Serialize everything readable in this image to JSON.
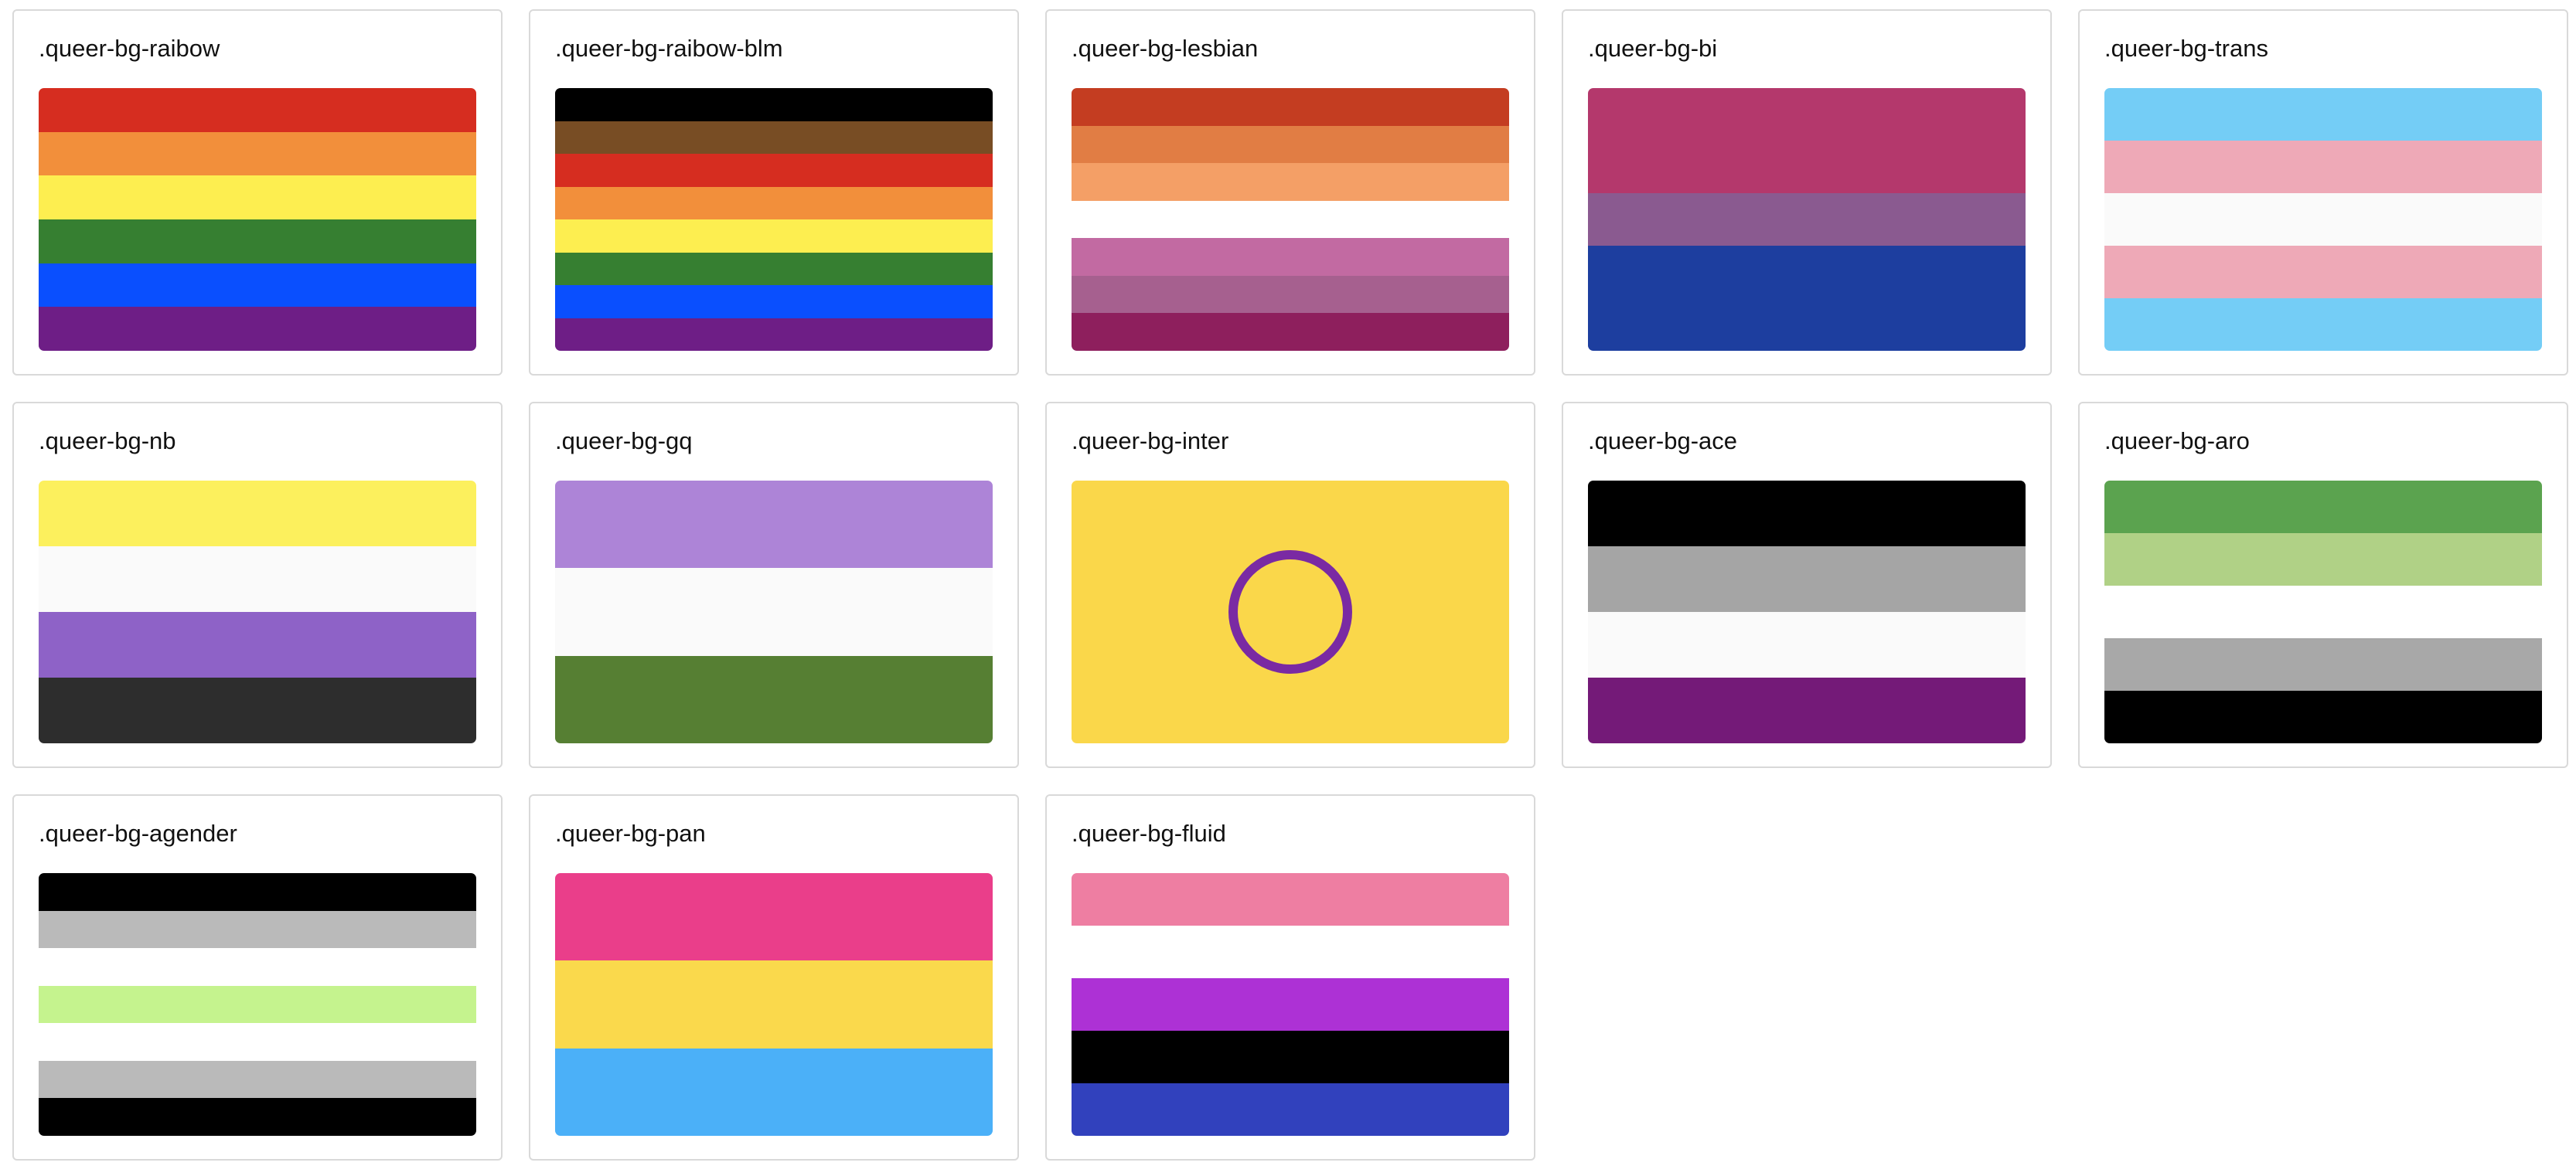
{
  "flags": [
    {
      "class_label": ".queer-bg-raibow",
      "stripes": [
        "#d62d20",
        "#f28f3b",
        "#fdee50",
        "#367f31",
        "#0a4ffe",
        "#6e1e86"
      ]
    },
    {
      "class_label": ".queer-bg-raibow-blm",
      "stripes": [
        "#000000",
        "#784d24",
        "#d62d20",
        "#f28f3b",
        "#fdee50",
        "#367f31",
        "#0a4ffe",
        "#6e1e86"
      ]
    },
    {
      "class_label": ".queer-bg-lesbian",
      "stripes": [
        "#c43d21",
        "#e17d44",
        "#f49f66",
        "#ffffff",
        "#c26aa2",
        "#a6608f",
        "#8e1f5d"
      ]
    },
    {
      "class_label": ".queer-bg-bi",
      "stripes": [
        "#b4386c",
        "#b4386c",
        "#8a5a90",
        "#1d3e9f",
        "#1d3e9f"
      ]
    },
    {
      "class_label": ".queer-bg-trans",
      "stripes": [
        "#74cdf6",
        "#eea9b7",
        "#fafafa",
        "#eea9b7",
        "#74cdf6"
      ]
    },
    {
      "class_label": ".queer-bg-nb",
      "stripes": [
        "#fcf05d",
        "#fafafa",
        "#8e62c7",
        "#2d2d2d"
      ]
    },
    {
      "class_label": ".queer-bg-gq",
      "stripes": [
        "#ad84d7",
        "#fafafa",
        "#567f33"
      ]
    },
    {
      "class_label": ".queer-bg-inter",
      "stripes": [
        "#fad74a"
      ],
      "ring_color": "#7a2aa3"
    },
    {
      "class_label": ".queer-bg-ace",
      "stripes": [
        "#000000",
        "#a5a5a5",
        "#fafafa",
        "#741a78"
      ]
    },
    {
      "class_label": ".queer-bg-aro",
      "stripes": [
        "#5ba34f",
        "#b0d186",
        "#ffffff",
        "#a8a8a8",
        "#000000"
      ]
    },
    {
      "class_label": ".queer-bg-agender",
      "stripes": [
        "#000000",
        "#bababa",
        "#ffffff",
        "#c5f38e",
        "#ffffff",
        "#bababa",
        "#000000"
      ]
    },
    {
      "class_label": ".queer-bg-pan",
      "stripes": [
        "#ea3e8a",
        "#fad94c",
        "#4bb0f8"
      ]
    },
    {
      "class_label": ".queer-bg-fluid",
      "stripes": [
        "#ee7ea2",
        "#ffffff",
        "#ad31d5",
        "#000000",
        "#3141bd"
      ]
    }
  ]
}
